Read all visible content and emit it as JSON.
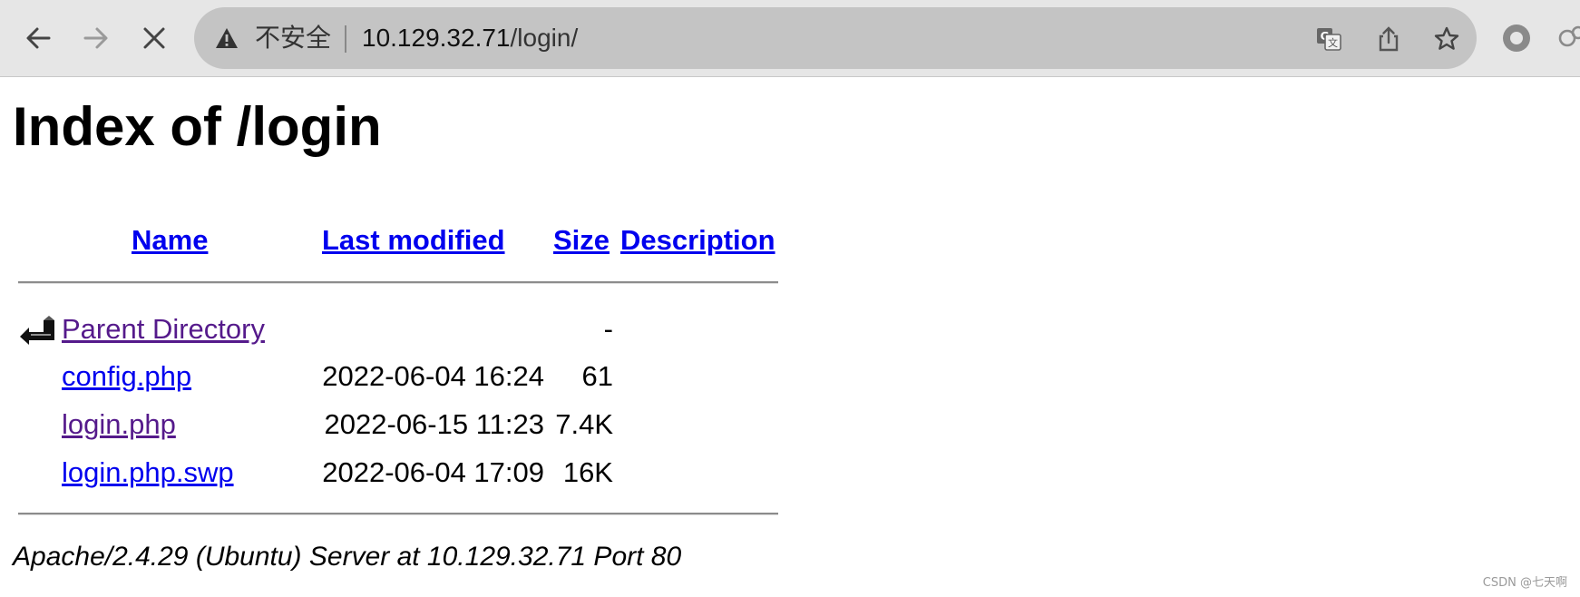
{
  "browser": {
    "security_label": "不安全",
    "url_host": "10.129.32.71",
    "url_path": "/login/",
    "icons": [
      "back-icon",
      "forward-icon",
      "stop-icon",
      "warning-icon",
      "translate-icon",
      "share-icon",
      "star-icon",
      "extension-icon"
    ]
  },
  "page": {
    "title": "Index of /login",
    "columns": {
      "name": "Name",
      "last_modified": "Last modified",
      "size": "Size",
      "description": "Description"
    },
    "rows": [
      {
        "name": "Parent Directory",
        "modified": "",
        "size": "-",
        "visited": true
      },
      {
        "name": "config.php",
        "modified": "2022-06-04 16:24",
        "size": "61",
        "visited": false
      },
      {
        "name": "login.php",
        "modified": "2022-06-15 11:23",
        "size": "7.4K",
        "visited": true
      },
      {
        "name": "login.php.swp",
        "modified": "2022-06-04 17:09",
        "size": "16K",
        "visited": false
      }
    ],
    "footer": "Apache/2.4.29 (Ubuntu) Server at 10.129.32.71 Port 80"
  },
  "watermark": "CSDN @七天啊",
  "colors": {
    "link": "#0000ee",
    "visited_link": "#551a8b",
    "toolbar": "#e6e6e6",
    "omnibox": "#c4c4c4"
  }
}
